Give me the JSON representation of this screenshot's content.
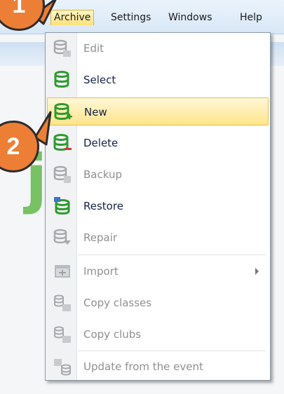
{
  "menubar": {
    "items": [
      {
        "label": "Archive"
      },
      {
        "label": "Settings"
      },
      {
        "label": "Windows"
      },
      {
        "label": "Help"
      }
    ]
  },
  "menu": {
    "items": [
      {
        "label": "Edit",
        "icon": "db-edit-icon",
        "disabled": true
      },
      {
        "label": "Select",
        "icon": "db-select-icon",
        "disabled": false
      },
      {
        "label": "New",
        "icon": "db-new-icon",
        "disabled": false,
        "highlighted": true
      },
      {
        "label": "Delete",
        "icon": "db-delete-icon",
        "disabled": false
      },
      {
        "label": "Backup",
        "icon": "db-backup-icon",
        "disabled": true
      },
      {
        "label": "Restore",
        "icon": "db-restore-icon",
        "disabled": false
      },
      {
        "label": "Repair",
        "icon": "db-repair-icon",
        "disabled": true
      },
      {
        "label": "Import",
        "icon": "import-icon",
        "disabled": true,
        "submenu": true
      },
      {
        "label": "Copy classes",
        "icon": "copy-classes-icon",
        "disabled": true
      },
      {
        "label": "Copy clubs",
        "icon": "copy-clubs-icon",
        "disabled": true
      },
      {
        "label": "Update from the event",
        "icon": "update-event-icon",
        "disabled": true
      }
    ]
  },
  "callouts": [
    {
      "label": "1"
    },
    {
      "label": "2"
    }
  ],
  "colors": {
    "callout": "#ec7f35",
    "highlight": "#ffe48a",
    "db_green": "#2f9a2f",
    "db_gray": "#a7a9ad"
  }
}
